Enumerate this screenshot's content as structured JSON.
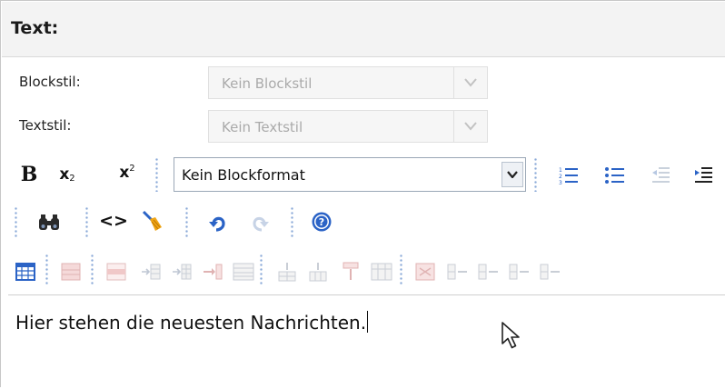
{
  "header": {
    "title": "Text:"
  },
  "block_style": {
    "label": "Blockstil:",
    "value": "Kein Blockstil"
  },
  "text_style": {
    "label": "Textstil:",
    "value": "Kein Textstil"
  },
  "toolbar": {
    "bold_label": "B",
    "subscript_label": "x",
    "subscript_digit": "2",
    "superscript_label": "x",
    "superscript_digit": "2",
    "block_format": "Kein Blockformat",
    "source_label": "<>"
  },
  "editor": {
    "content": "Hier stehen die neuesten Nachrichten."
  },
  "icons": [
    "ordered-list-icon",
    "unordered-list-icon",
    "outdent-icon",
    "indent-icon",
    "find-icon",
    "html-source-icon",
    "clean-broom-icon",
    "undo-icon",
    "redo-icon",
    "help-icon",
    "table-icon",
    "table-properties-icon",
    "row-properties-icon",
    "column-insert-before-icon",
    "column-insert-after-icon",
    "column-delete-icon",
    "split-cell-icon",
    "row-insert-above-icon",
    "row-insert-below-icon",
    "row-delete-icon",
    "merge-cells-icon",
    "cell-properties-icon",
    "row-split-icon",
    "cell-insert-before-icon",
    "cell-insert-after-icon",
    "cell-delete-icon"
  ],
  "colors": {
    "accent_blue": "#2b63c6",
    "separator": "#8aa9d8",
    "toolbar_bg": "#f1f1f1",
    "disabled_text": "#aaaaaa"
  }
}
